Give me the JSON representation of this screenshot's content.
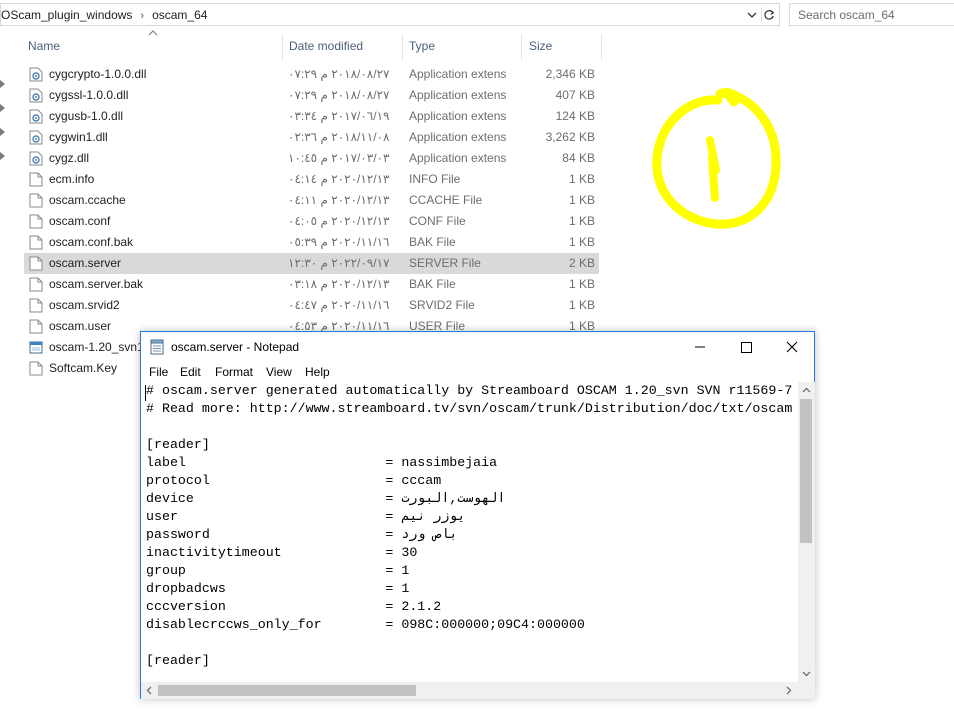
{
  "explorer": {
    "breadcrumbs": [
      "OScam_plugin_windows",
      "oscam_64"
    ],
    "search_placeholder": "Search oscam_64",
    "columns": {
      "name": "Name",
      "date_modified": "Date modified",
      "type": "Type",
      "size": "Size"
    },
    "files": [
      {
        "name": "cygcrypto-1.0.0.dll",
        "date": "٢٠١٨/٠٨/٢٧ م ٠٧:٢٩",
        "type": "Application extens",
        "size": "2,346 KB",
        "icon": "dll-icon"
      },
      {
        "name": "cygssl-1.0.0.dll",
        "date": "٢٠١٨/٠٨/٢٧ م ٠٧:٢٩",
        "type": "Application extens",
        "size": "407 KB",
        "icon": "dll-icon"
      },
      {
        "name": "cygusb-1.0.dll",
        "date": "٢٠١٧/٠٦/١٩ م ٠٣:٣٤",
        "type": "Application extens",
        "size": "124 KB",
        "icon": "dll-icon"
      },
      {
        "name": "cygwin1.dll",
        "date": "٢٠١٨/١١/٠٨ م ٠٢:٣٦",
        "type": "Application extens",
        "size": "3,262 KB",
        "icon": "dll-icon"
      },
      {
        "name": "cygz.dll",
        "date": "٢٠١٧/٠٣/٠٣ م ١٠:٤٥",
        "type": "Application extens",
        "size": "84 KB",
        "icon": "dll-icon"
      },
      {
        "name": "ecm.info",
        "date": "٢٠٢٠/١٢/١٣ م ٠٤:١٤",
        "type": "INFO File",
        "size": "1 KB",
        "icon": "file-icon"
      },
      {
        "name": "oscam.ccache",
        "date": "٢٠٢٠/١٢/١٣ م ٠٤:١١",
        "type": "CCACHE File",
        "size": "1 KB",
        "icon": "file-icon"
      },
      {
        "name": "oscam.conf",
        "date": "٢٠٢٠/١٢/١٣ م ٠٤:٠٥",
        "type": "CONF File",
        "size": "1 KB",
        "icon": "file-icon"
      },
      {
        "name": "oscam.conf.bak",
        "date": "٢٠٢٠/١١/١٦ م ٠٥:٣٩",
        "type": "BAK File",
        "size": "1 KB",
        "icon": "file-icon"
      },
      {
        "name": "oscam.server",
        "date": "٢٠٢٢/٠٩/١٧ م ١٢:٣٠",
        "type": "SERVER File",
        "size": "2 KB",
        "icon": "file-icon"
      },
      {
        "name": "oscam.server.bak",
        "date": "٢٠٢٠/١٢/١٣ م ٠٣:١٨",
        "type": "BAK File",
        "size": "1 KB",
        "icon": "file-icon"
      },
      {
        "name": "oscam.srvid2",
        "date": "٢٠٢٠/١١/١٦ م ٠٤:٤٧",
        "type": "SRVID2 File",
        "size": "1 KB",
        "icon": "file-icon"
      },
      {
        "name": "oscam.user",
        "date": "٢٠٢٠/١١/١٦ م ٠٤:٥٣",
        "type": "USER File",
        "size": "1 KB",
        "icon": "file-icon"
      },
      {
        "name": "oscam-1.20_svn1",
        "date": "",
        "type": "",
        "size": "",
        "icon": "exe-icon"
      },
      {
        "name": "Softcam.Key",
        "date": "",
        "type": "",
        "size": "",
        "icon": "file-icon"
      }
    ],
    "selected_file": "oscam.server"
  },
  "annotation": {
    "color": "#ffff00",
    "shape": "circled-number-one"
  },
  "notepad": {
    "title": "oscam.server - Notepad",
    "menu": [
      "File",
      "Edit",
      "Format",
      "View",
      "Help"
    ],
    "lines": [
      "# oscam.server generated automatically by Streamboard OSCAM 1.20_svn SVN r11569-7",
      "# Read more: http://www.streamboard.tv/svn/oscam/trunk/Distribution/doc/txt/oscam",
      "",
      "[reader]",
      "label                         = nassimbejaia",
      "protocol                      = cccam",
      "device                        = الهوست,البورت",
      "user                          = يوزر نيم",
      "password                      = باص ورد",
      "inactivitytimeout             = 30",
      "group                         = 1",
      "dropbadcws                    = 1",
      "cccversion                    = 2.1.2",
      "disablecrccws_only_for        = 098C:000000;09C4:000000",
      "",
      "[reader]"
    ]
  },
  "colors": {
    "selection": "#d9d9d9",
    "window_border": "#2b79d6",
    "header_text": "#4c607a"
  }
}
